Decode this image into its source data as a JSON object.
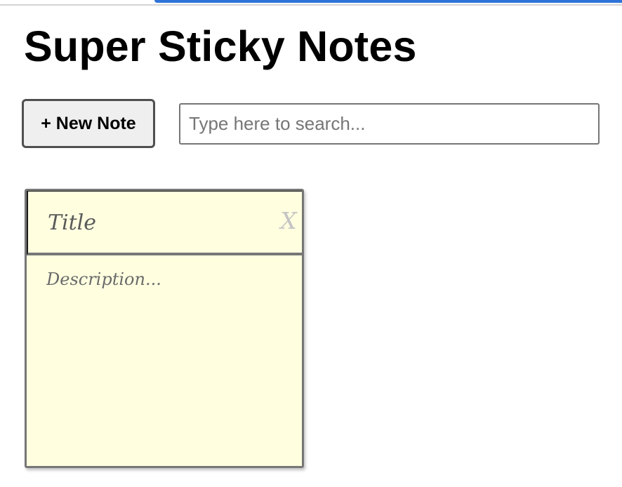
{
  "app": {
    "title": "Super Sticky Notes"
  },
  "toolbar": {
    "new_note_label": "+ New Note",
    "search_placeholder": "Type here to search...",
    "search_value": ""
  },
  "notes": [
    {
      "title_placeholder": "Title",
      "title_value": "",
      "close_label": "X",
      "description_placeholder": "Description...",
      "description_value": ""
    }
  ],
  "colors": {
    "note_background": "#ffffe0",
    "note_border": "#777777",
    "button_background": "#efefef",
    "accent_blue": "#2f73d9"
  }
}
